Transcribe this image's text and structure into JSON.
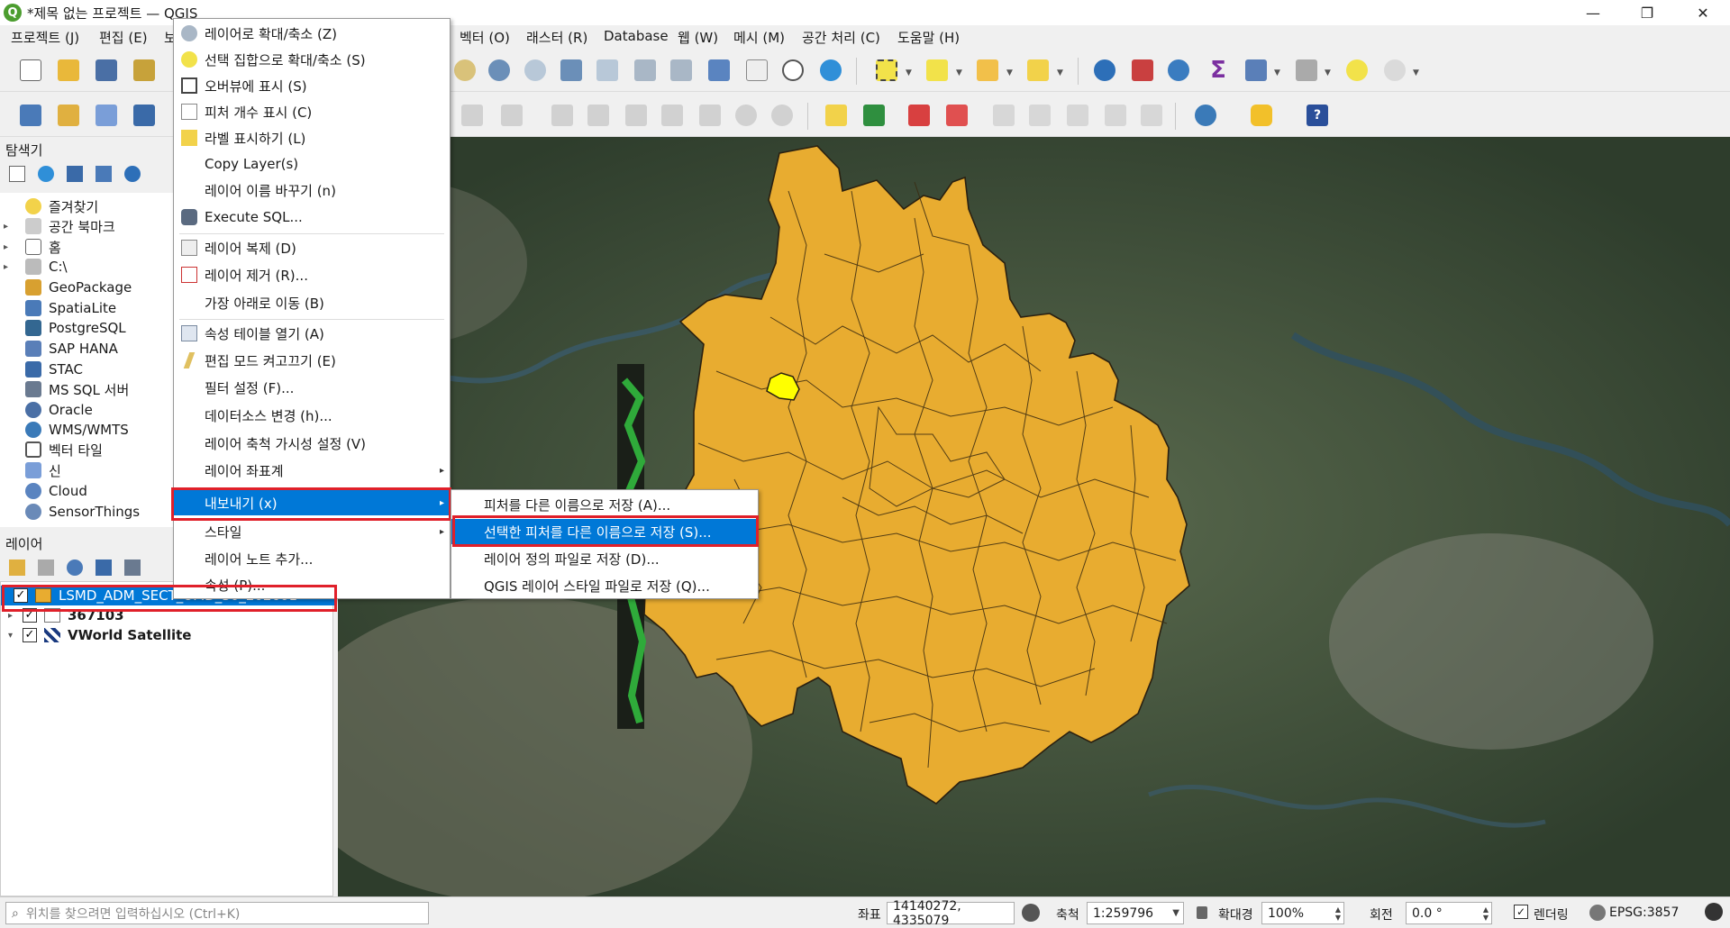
{
  "window": {
    "title": "*제목 없는 프로젝트 — QGIS",
    "minimize": "—",
    "maximize": "❐",
    "close": "✕"
  },
  "menu": [
    "프로젝트 (J)",
    "편집 (E)",
    "보",
    "벡터 (O)",
    "래스터 (R)",
    "Database",
    "웹 (W)",
    "메시 (M)",
    "공간 처리 (C)",
    "도움말 (H)"
  ],
  "browser": {
    "title": "탐색기",
    "items": [
      {
        "label": "즐겨찾기",
        "icon": "star-icon",
        "arrow": ""
      },
      {
        "label": "공간 북마크",
        "icon": "bookmark-icon",
        "arrow": "▸"
      },
      {
        "label": "홈",
        "icon": "home-folder-icon",
        "arrow": "▸"
      },
      {
        "label": "C:\\",
        "icon": "drive-icon",
        "arrow": "▸"
      },
      {
        "label": "GeoPackage",
        "icon": "geopackage-icon",
        "arrow": ""
      },
      {
        "label": "SpatiaLite",
        "icon": "spatialite-icon",
        "arrow": ""
      },
      {
        "label": "PostgreSQL",
        "icon": "postgresql-icon",
        "arrow": ""
      },
      {
        "label": "SAP HANA",
        "icon": "sap-hana-icon",
        "arrow": ""
      },
      {
        "label": "STAC",
        "icon": "stac-icon",
        "arrow": ""
      },
      {
        "label": "MS SQL 서버",
        "icon": "mssql-icon",
        "arrow": ""
      },
      {
        "label": "Oracle",
        "icon": "oracle-icon",
        "arrow": ""
      },
      {
        "label": "WMS/WMTS",
        "icon": "wms-icon",
        "arrow": ""
      },
      {
        "label": "벡터 타일",
        "icon": "vector-tile-icon",
        "arrow": ""
      },
      {
        "label": "신",
        "icon": "xyz-icon",
        "arrow": ""
      },
      {
        "label": "Cloud",
        "icon": "cloud-icon",
        "arrow": ""
      },
      {
        "label": "SensorThings",
        "icon": "sensorthings-icon",
        "arrow": ""
      }
    ]
  },
  "layers": {
    "title": "레이어",
    "items": [
      {
        "label": "LSMD_ADM_SECT_UMD_30_202601",
        "checked": "✓",
        "arrow": "",
        "selected": true
      },
      {
        "label": "367103",
        "checked": "✓",
        "arrow": "▸",
        "selected": false
      },
      {
        "label": "VWorld Satellite",
        "checked": "✓",
        "arrow": "▾",
        "selected": false
      }
    ]
  },
  "context_menu": {
    "items": [
      {
        "label": "레이어로 확대/축소 (Z)",
        "icon": "zoom-layer-icon"
      },
      {
        "label": "선택 집합으로 확대/축소 (S)",
        "icon": "zoom-selection-icon"
      },
      {
        "label": "오버뷰에 표시 (S)",
        "icon": "overview-icon"
      },
      {
        "label": "피처 개수 표시 (C)",
        "icon": "checkbox-icon"
      },
      {
        "label": "라벨 표시하기 (L)",
        "icon": "label-icon"
      },
      {
        "label": "Copy Layer(s)",
        "icon": ""
      },
      {
        "label": "레이어 이름 바꾸기 (n)",
        "icon": ""
      },
      {
        "label": "Execute SQL...",
        "icon": "sql-icon"
      },
      {
        "label": "레이어 복제 (D)",
        "icon": "duplicate-icon"
      },
      {
        "label": "레이어 제거 (R)...",
        "icon": "remove-layer-icon"
      },
      {
        "label": "가장 아래로 이동 (B)",
        "icon": ""
      },
      {
        "label": "속성 테이블 열기 (A)",
        "icon": "table-icon"
      },
      {
        "label": "편집 모드 켜고끄기 (E)",
        "icon": "pencil-icon"
      },
      {
        "label": "필터 설정 (F)...",
        "icon": ""
      },
      {
        "label": "데이터소스 변경 (h)...",
        "icon": ""
      },
      {
        "label": "레이어 축척 가시성 설정 (V)",
        "icon": ""
      },
      {
        "label": "레이어 좌표계",
        "icon": ""
      },
      {
        "label": "내보내기 (x)",
        "icon": ""
      },
      {
        "label": "스타일",
        "icon": ""
      },
      {
        "label": "레이어 노트 추가...",
        "icon": ""
      },
      {
        "label": "속성 (P)...",
        "icon": ""
      }
    ]
  },
  "export_submenu": {
    "items": [
      "피처를 다른 이름으로 저장 (A)...",
      "선택한 피처를 다른 이름으로 저장 (S)...",
      "레이어 정의 파일로 저장 (D)...",
      "QGIS 레이어 스타일 파일로 저장 (Q)..."
    ]
  },
  "status": {
    "search_placeholder": "위치를 찾으려면 입력하십시오 (Ctrl+K)",
    "coord_label": "좌표",
    "coord_value": "14140272, 4335079",
    "scale_label": "축척",
    "scale_value": "1:259796",
    "magnifier_label": "확대경",
    "magnifier_value": "100%",
    "rotation_label": "회전",
    "rotation_value": "0.0 °",
    "render_label": "렌더링",
    "crs": "EPSG:3857"
  },
  "colors": {
    "polygon_fill": "#e8ac30",
    "polygon_stroke": "#2a2010",
    "selected_feature": "#ffff00",
    "highlight": "#0078d7",
    "red_box": "#e0202a"
  }
}
